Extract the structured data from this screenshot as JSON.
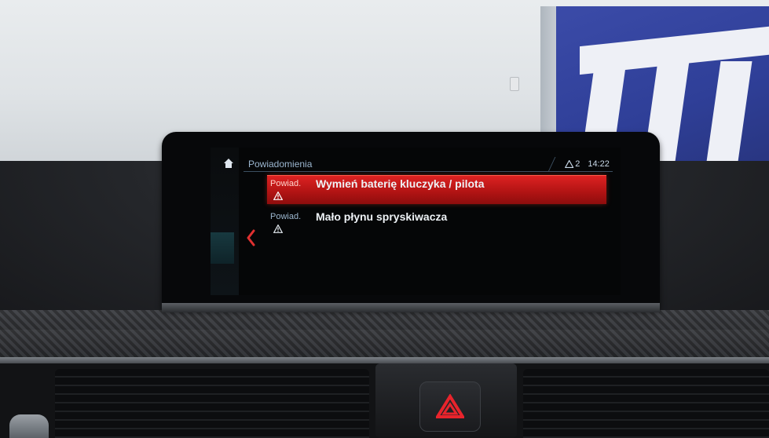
{
  "header": {
    "title": "Powiadomienia",
    "warning_count": "2",
    "clock": "14:22"
  },
  "notifications": [
    {
      "category": "Powiad.",
      "message": "Wymień baterię kluczyka / pilota",
      "icon": "warning-triangle-icon",
      "selected": true
    },
    {
      "category": "Powiad.",
      "message": "Mało płynu spryskiwacza",
      "icon": "warning-triangle-icon",
      "selected": false
    }
  ],
  "icons": {
    "home": "home-icon",
    "back": "back-chevron-icon",
    "header_warning": "warning-triangle-icon"
  },
  "colors": {
    "selection_red": "#c81818",
    "header_text": "#9bb6cf",
    "back_chevron": "#e03030",
    "hazard_red": "#d8202a"
  }
}
